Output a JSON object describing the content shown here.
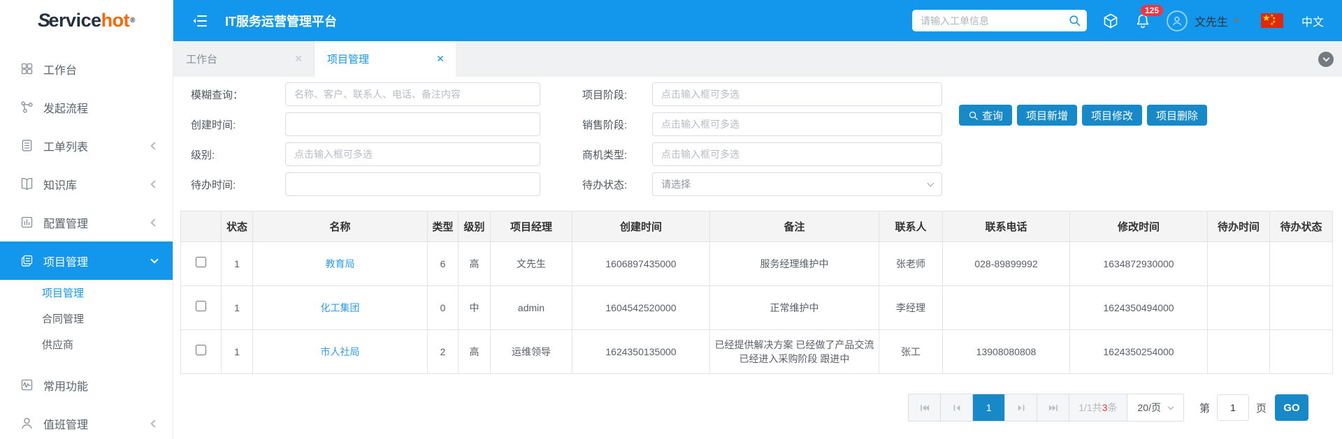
{
  "colors": {
    "header_blue": "#1297ec",
    "button_blue": "#1789c9",
    "link_blue": "#2f9ded",
    "badge_red": "#f5333f",
    "count_red": "#f0383d"
  },
  "logo": {
    "part1": "S",
    "part2": "ervice",
    "part3": "hot",
    "reg": "®"
  },
  "topbar": {
    "title": "IT服务运营管理平台",
    "search_placeholder": "请输入工单信息",
    "badge": "125",
    "user": "文先生",
    "lang": "中文"
  },
  "sidebar": {
    "items": [
      {
        "label": "工作台",
        "icon": "grid-icon"
      },
      {
        "label": "发起流程",
        "icon": "flow-icon"
      },
      {
        "label": "工单列表",
        "icon": "worklist-icon",
        "chevron": "left"
      },
      {
        "label": "知识库",
        "icon": "book-icon",
        "chevron": "left"
      },
      {
        "label": "配置管理",
        "icon": "config-icon",
        "chevron": "left"
      },
      {
        "label": "项目管理",
        "icon": "project-icon",
        "chevron": "down",
        "active": true,
        "children": [
          {
            "label": "项目管理",
            "active": true
          },
          {
            "label": "合同管理"
          },
          {
            "label": "供应商"
          }
        ]
      },
      {
        "label": "常用功能",
        "icon": "monitor-icon"
      },
      {
        "label": "值班管理",
        "icon": "person-icon",
        "chevron": "left"
      }
    ]
  },
  "tabs": [
    {
      "label": "工作台",
      "close": "✕",
      "active": false
    },
    {
      "label": "项目管理",
      "close": "✕",
      "active": true
    }
  ],
  "filters": {
    "left": [
      {
        "label": "模糊查询：",
        "placeholder": "名称、客户、联系人、电话、备注内容",
        "value": ""
      },
      {
        "label": "创建时间:",
        "placeholder": "",
        "value": ""
      },
      {
        "label": "级别:",
        "placeholder": "点击输入框可多选",
        "value": ""
      },
      {
        "label": "待办时间:",
        "placeholder": "",
        "value": ""
      }
    ],
    "right": [
      {
        "label": "项目阶段:",
        "placeholder": "点击输入框可多选"
      },
      {
        "label": "销售阶段:",
        "placeholder": "点击输入框可多选"
      },
      {
        "label": "商机类型:",
        "placeholder": "点击输入框可多选"
      },
      {
        "label": "待办状态:",
        "placeholder": "请选择"
      }
    ]
  },
  "actions": {
    "search": "查询",
    "add": "项目新增",
    "edit": "项目修改",
    "delete": "项目删除"
  },
  "table": {
    "headers": [
      "",
      "状态",
      "名称",
      "类型",
      "级别",
      "项目经理",
      "创建时间",
      "备注",
      "联系人",
      "联系电话",
      "修改时间",
      "待办时间",
      "待办状态"
    ],
    "rows": [
      {
        "status": "1",
        "name": "教育局",
        "type": "6",
        "level": "高",
        "manager": "文先生",
        "created": "1606897435000",
        "remark": "服务经理维护中",
        "contact": "张老师",
        "phone": "028-89899992",
        "modified": "1634872930000",
        "todo_time": "",
        "todo_status": ""
      },
      {
        "status": "1",
        "name": "化工集团",
        "type": "0",
        "level": "中",
        "manager": "admin",
        "created": "1604542520000",
        "remark": "正常维护中",
        "contact": "李经理",
        "phone": "",
        "modified": "1624350494000",
        "todo_time": "",
        "todo_status": ""
      },
      {
        "status": "1",
        "name": "市人社局",
        "type": "2",
        "level": "高",
        "manager": "运维领导",
        "created": "1624350135000",
        "remark": "已经提供解决方案 已经做了产品交流 已经进入采购阶段 跟进中",
        "contact": "张工",
        "phone": "13908080808",
        "modified": "1624350254000",
        "todo_time": "",
        "todo_status": ""
      }
    ]
  },
  "pagination": {
    "active_page": "1",
    "info_part1": "1/1共",
    "info_count": "3",
    "info_part2": "条",
    "page_size": "20/页",
    "jump_prefix": "第",
    "jump_value": "1",
    "jump_suffix": "页",
    "go_label": "GO"
  }
}
